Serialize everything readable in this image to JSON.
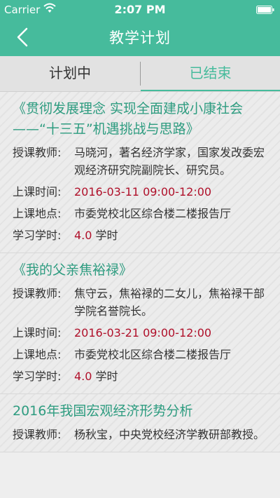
{
  "status": {
    "carrier": "Carrier",
    "time": "2:07 PM"
  },
  "header": {
    "title": "教学计划"
  },
  "tabs": [
    {
      "label": "计划中",
      "active": false
    },
    {
      "label": "已结束",
      "active": true
    }
  ],
  "colors": {
    "accent": "#46bb9c",
    "title_green": "#2e9c80",
    "highlight_red": "#b0102a"
  },
  "labels": {
    "teacher": "授课教师:",
    "time": "上课时间:",
    "location": "上课地点:",
    "hours": "学习学时:"
  },
  "courses": [
    {
      "title": "《贯彻发展理念 实现全面建成小康社会——“十三五”机遇挑战与思路》",
      "teacher": "马晓河，著名经济学家，国家发改委宏观经济研究院副院长、研究员。",
      "time": "2016-03-11 09:00-12:00",
      "location": "市委党校北区综合楼二楼报告厅",
      "hours_value": "4.0",
      "hours_unit": " 学时"
    },
    {
      "title": "《我的父亲焦裕禄》",
      "teacher": "焦守云，焦裕禄的二女儿，焦裕禄干部学院名誉院长。",
      "time": "2016-03-21 09:00-12:00",
      "location": "市委党校北区综合楼二楼报告厅",
      "hours_value": "4.0",
      "hours_unit": " 学时"
    },
    {
      "title": "2016年我国宏观经济形势分析",
      "teacher": "杨秋宝，中央党校经济学教研部教授。"
    }
  ]
}
